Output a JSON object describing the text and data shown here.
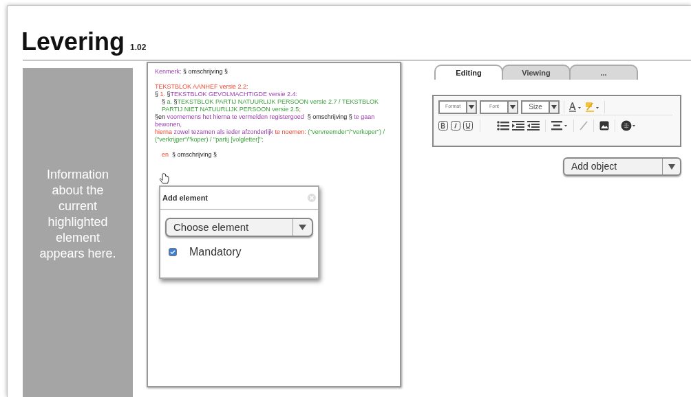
{
  "title": "Levering",
  "version": "1.02",
  "info_panel": {
    "text": "Information about the current highlighted element appears here."
  },
  "document": {
    "paragraphs": [
      {
        "indent": false,
        "segments": [
          {
            "text": "Kenmerk:",
            "kind": "label"
          },
          {
            "text": " § omschrijving §",
            "kind": "plain"
          }
        ]
      },
      {
        "indent": false,
        "gap": true,
        "segments": [
          {
            "text": "TEKSTBLOK AANHEF versie 2.2:",
            "kind": "keyword"
          }
        ]
      },
      {
        "indent": false,
        "segments": [
          {
            "text": "§ ",
            "kind": "plain"
          },
          {
            "text": "1. ",
            "kind": "keyword"
          },
          {
            "text": "§",
            "kind": "plain"
          },
          {
            "text": "TEKSTBLOK GEVOLMACHTIGDE versie 2.4:",
            "kind": "label"
          }
        ]
      },
      {
        "indent": true,
        "segments": [
          {
            "text": "§ ",
            "kind": "plain"
          },
          {
            "text": "a. ",
            "kind": "option"
          },
          {
            "text": "§",
            "kind": "plain"
          },
          {
            "text": "TEKSTBLOK PARTIJ NATUURLIJK PERSOON versie 2.7 / TEKSTBLOK PARTIJ NIET NATUURLIJK PERSOON versie 2.5",
            "kind": "option"
          },
          {
            "text": ";",
            "kind": "keyword"
          }
        ]
      },
      {
        "indent": false,
        "segments": [
          {
            "text": "§en",
            "kind": "plain"
          },
          {
            "text": " voornemens het hierna te vermelden registergoed",
            "kind": "label"
          },
          {
            "text": "  § omschrijving §",
            "kind": "plain"
          },
          {
            "text": " te gaan bewonen,",
            "kind": "label"
          }
        ]
      },
      {
        "indent": false,
        "segments": [
          {
            "text": "hierna",
            "kind": "keyword"
          },
          {
            "text": " zowel tezamen als ieder afzonderlijk",
            "kind": "label"
          },
          {
            "text": " te noemen:",
            "kind": "keyword"
          },
          {
            "text": " (\"vervreemder\"/\"verkoper\") / (\"verkrijger\"/\"koper) / \"partij [volgletter]\";",
            "kind": "option"
          }
        ]
      },
      {
        "indent": true,
        "gap": true,
        "segments": [
          {
            "text": "en",
            "kind": "keyword"
          },
          {
            "text": "  § omschrijving §",
            "kind": "plain"
          }
        ]
      }
    ]
  },
  "popup": {
    "title": "Add element",
    "select": {
      "value": "Choose element"
    },
    "checkbox": {
      "label": "Mandatory",
      "checked": true
    }
  },
  "tabs": [
    {
      "label": "Editing",
      "selected": true
    },
    {
      "label": "Viewing",
      "selected": false
    },
    {
      "label": "...",
      "selected": false
    }
  ],
  "toolbar": {
    "dropdowns": [
      {
        "label": "Format",
        "kind": "small"
      },
      {
        "label": "Font",
        "kind": "small"
      },
      {
        "label": "Size",
        "kind": "normal"
      }
    ]
  },
  "add_object": {
    "value": "Add object"
  }
}
